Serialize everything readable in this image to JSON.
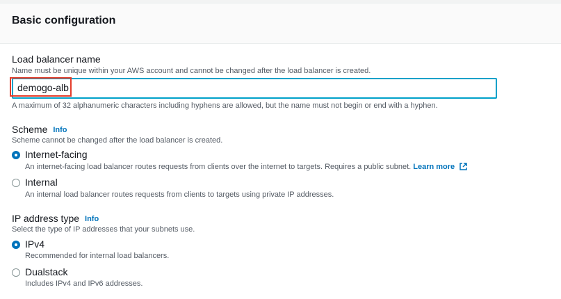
{
  "section": {
    "title": "Basic configuration"
  },
  "load_balancer_name": {
    "label": "Load balancer name",
    "description": "Name must be unique within your AWS account and cannot be changed after the load balancer is created.",
    "value": "demogo-alb",
    "constraint": "A maximum of 32 alphanumeric characters including hyphens are allowed, but the name must not begin or end with a hyphen."
  },
  "scheme": {
    "label": "Scheme",
    "info": "Info",
    "description": "Scheme cannot be changed after the load balancer is created.",
    "options": [
      {
        "label": "Internet-facing",
        "description": "An internet-facing load balancer routes requests from clients over the internet to targets. Requires a public subnet.",
        "link": "Learn more",
        "checked": true
      },
      {
        "label": "Internal",
        "description": "An internal load balancer routes requests from clients to targets using private IP addresses.",
        "checked": false
      }
    ]
  },
  "ip_address_type": {
    "label": "IP address type",
    "info": "Info",
    "description": "Select the type of IP addresses that your subnets use.",
    "options": [
      {
        "label": "IPv4",
        "description": "Recommended for internal load balancers.",
        "checked": true
      },
      {
        "label": "Dualstack",
        "description": "Includes IPv4 and IPv6 addresses.",
        "checked": false
      }
    ]
  },
  "colors": {
    "accent": "#0073bb",
    "focus_border": "#00a1c9",
    "highlight_box": "#e43c2a"
  }
}
